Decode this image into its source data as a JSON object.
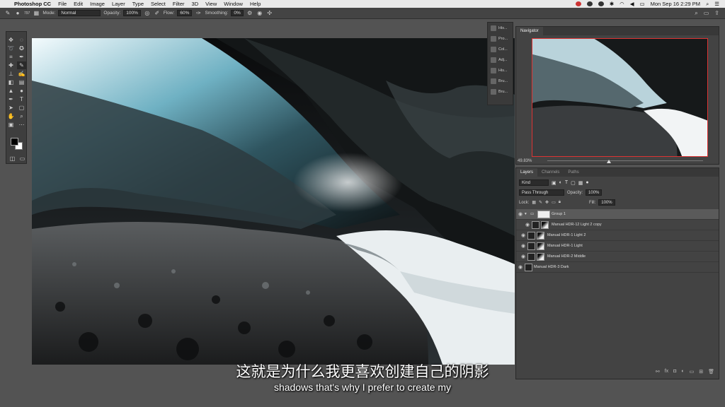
{
  "menubar": {
    "app_name": "Photoshop CC",
    "items": [
      "File",
      "Edit",
      "Image",
      "Layer",
      "Type",
      "Select",
      "Filter",
      "3D",
      "View",
      "Window",
      "Help"
    ],
    "clock": "Mon Sep 16  2:29 PM"
  },
  "options": {
    "brush_size": "797",
    "mode_label": "Mode:",
    "mode_value": "Normal",
    "opacity_label": "Opacity:",
    "opacity_value": "100%",
    "flow_label": "Flow:",
    "flow_value": "60%",
    "smoothing_label": "Smoothing:",
    "smoothing_value": "0%"
  },
  "panel_strip": {
    "items": [
      "His...",
      "Pro...",
      "Col...",
      "Adj...",
      "His...",
      "Bru...",
      "Bru..."
    ]
  },
  "navigator": {
    "tab": "Navigator",
    "zoom": "49.83%"
  },
  "layers": {
    "tabs": [
      "Layers",
      "Channels",
      "Paths"
    ],
    "filter_kind": "Kind",
    "blend_mode": "Pass Through",
    "opacity_label": "Opacity:",
    "opacity_value": "100%",
    "lock_label": "Lock:",
    "fill_label": "Fill:",
    "fill_value": "100%",
    "rows": [
      {
        "name": "Group 1"
      },
      {
        "name": "Manual HDR-12 Light 2 copy"
      },
      {
        "name": "Manual HDR-1 Light 2"
      },
      {
        "name": "Manual HDR-1 Light"
      },
      {
        "name": "Manual HDR-2 Middle"
      },
      {
        "name": "Manual HDR-3 Dark"
      }
    ]
  },
  "captions": {
    "chinese": "这就是为什么我更喜欢创建自己的阴影",
    "english": "shadows that's why I prefer to create my"
  }
}
